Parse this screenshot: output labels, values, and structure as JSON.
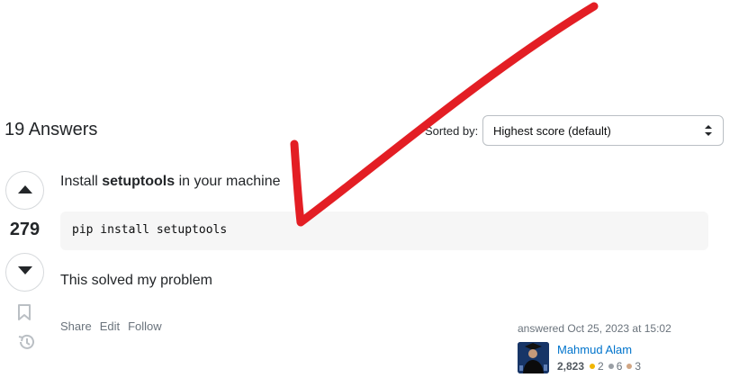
{
  "header": {
    "answers_title": "19 Answers",
    "sort_label": "Sorted by:",
    "sort_value": "Highest score (default)"
  },
  "answer": {
    "vote_count": "279",
    "text_before": "Install ",
    "text_bold": "setuptools",
    "text_after": " in your machine",
    "code": "pip install setuptools",
    "solved_text": "This solved my problem",
    "menu": {
      "share": "Share",
      "edit": "Edit",
      "follow": "Follow"
    },
    "signature": {
      "action_time": "answered Oct 25, 2023 at 15:02",
      "user_name": "Mahmud Alam",
      "reputation": "2,823",
      "gold": "2",
      "silver": "6",
      "bronze": "3"
    }
  },
  "colors": {
    "link": "#0074cc",
    "gold": "#f1b600",
    "silver": "#9a9fa5",
    "bronze": "#d1a684",
    "checkmark": "#e31e24"
  },
  "icons": [
    "caret-up-icon",
    "caret-down-icon",
    "bookmark-icon",
    "history-icon",
    "select-arrows-icon",
    "checkmark-drawing"
  ]
}
